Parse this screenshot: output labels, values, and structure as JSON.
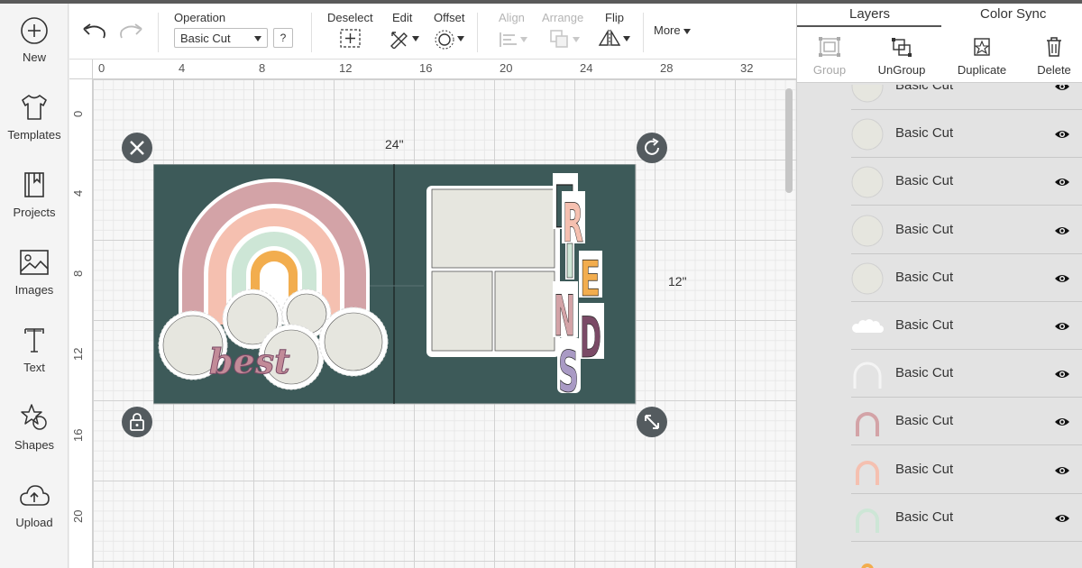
{
  "sidebar": {
    "items": [
      {
        "label": "New",
        "icon": "plus-circle-icon"
      },
      {
        "label": "Templates",
        "icon": "tshirt-icon"
      },
      {
        "label": "Projects",
        "icon": "book-icon"
      },
      {
        "label": "Images",
        "icon": "image-icon"
      },
      {
        "label": "Text",
        "icon": "text-icon"
      },
      {
        "label": "Shapes",
        "icon": "shapes-icon"
      },
      {
        "label": "Upload",
        "icon": "upload-cloud-icon"
      }
    ]
  },
  "toolbar": {
    "operation_label": "Operation",
    "operation_value": "Basic Cut",
    "help_label": "?",
    "deselect_label": "Deselect",
    "edit_label": "Edit",
    "offset_label": "Offset",
    "align_label": "Align",
    "arrange_label": "Arrange",
    "flip_label": "Flip",
    "more_label": "More"
  },
  "canvas": {
    "ruler_top": [
      "0",
      "4",
      "8",
      "12",
      "16",
      "20",
      "24",
      "28",
      "32"
    ],
    "ruler_left": [
      "0",
      "4",
      "8",
      "12",
      "16",
      "20"
    ],
    "width_label": "24\"",
    "height_label": "12\"",
    "colors": {
      "board": "#3d5a59",
      "rose": "#d3a3a7",
      "peach": "#f5c0b0",
      "mint": "#cde6d6",
      "orange": "#f2ad4e",
      "plum": "#7a4a66",
      "lavender": "#a99ac4",
      "cream": "#e6e6df"
    },
    "word_best": "best",
    "word_friends": "FRIENDS"
  },
  "rpanel": {
    "tabs": {
      "layers": "Layers",
      "color_sync": "Color Sync"
    },
    "actions": {
      "group": "Group",
      "ungroup": "UnGroup",
      "duplicate": "Duplicate",
      "delete": "Delete"
    },
    "layers": [
      {
        "name": "Basic Cut",
        "thumb": "circle"
      },
      {
        "name": "Basic Cut",
        "thumb": "circle"
      },
      {
        "name": "Basic Cut",
        "thumb": "circle"
      },
      {
        "name": "Basic Cut",
        "thumb": "circle"
      },
      {
        "name": "Basic Cut",
        "thumb": "circle"
      },
      {
        "name": "Basic Cut",
        "thumb": "cloud"
      },
      {
        "name": "Basic Cut",
        "thumb": "rainbow-outline"
      },
      {
        "name": "Basic Cut",
        "thumb": "arch-rose"
      },
      {
        "name": "Basic Cut",
        "thumb": "arch-peach"
      },
      {
        "name": "Basic Cut",
        "thumb": "arch-mint"
      },
      {
        "name": "",
        "thumb": "arch-orange"
      }
    ]
  }
}
